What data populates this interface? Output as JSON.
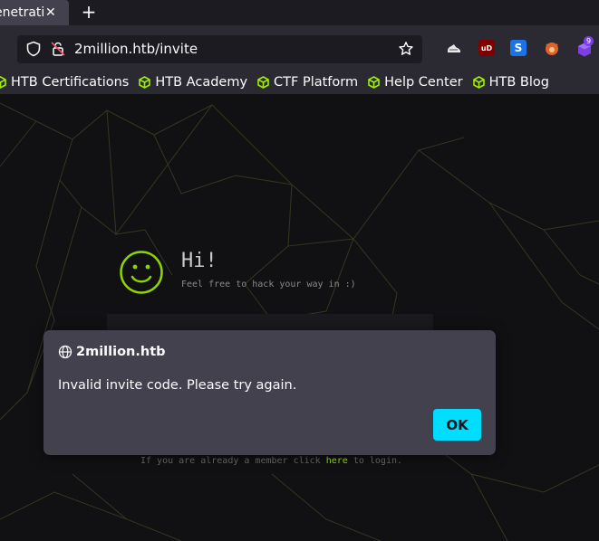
{
  "tabs": [
    {
      "title": "enetratio",
      "active": true
    }
  ],
  "toolbar": {
    "url": "2million.htb/invite"
  },
  "extensions": [
    {
      "icon": "shoe-icon"
    },
    {
      "icon": "ublock-icon",
      "label": "uD"
    },
    {
      "icon": "s-icon",
      "label": "S"
    },
    {
      "icon": "fox-icon"
    },
    {
      "icon": "purple-cube-icon",
      "badge": "9"
    }
  ],
  "bookmarks": [
    {
      "label": "HTB Certifications"
    },
    {
      "label": "HTB Academy"
    },
    {
      "label": "CTF Platform"
    },
    {
      "label": "Help Center"
    },
    {
      "label": "HTB Blog"
    }
  ],
  "page": {
    "greeting": "Hi!",
    "tagline": "Feel free to hack your way in :)",
    "login_prefix": "If you are already a member click ",
    "login_link": "here",
    "login_suffix": " to login."
  },
  "dialog": {
    "origin": "2million.htb",
    "message": "Invalid invite code. Please try again.",
    "ok_label": "OK"
  },
  "colors": {
    "accent": "#00ddff",
    "htb_green": "#9fef00",
    "dialog_bg": "#42414d",
    "toolbar_bg": "#2b2a33"
  }
}
